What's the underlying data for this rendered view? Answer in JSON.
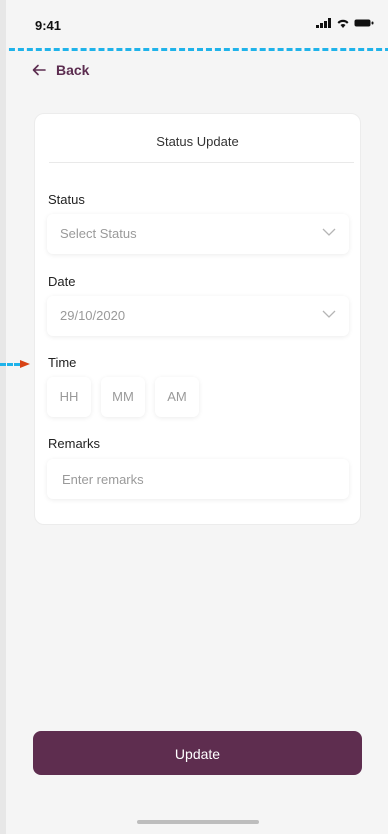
{
  "status_bar": {
    "time": "9:41"
  },
  "nav": {
    "back_label": "Back"
  },
  "card": {
    "title": "Status Update",
    "status": {
      "label": "Status",
      "placeholder": "Select Status"
    },
    "date": {
      "label": "Date",
      "value": "29/10/2020"
    },
    "time": {
      "label": "Time",
      "hour": "HH",
      "minute": "MM",
      "period": "AM"
    },
    "remarks": {
      "label": "Remarks",
      "placeholder": "Enter remarks"
    }
  },
  "actions": {
    "update_label": "Update"
  },
  "colors": {
    "accent": "#5e2d4f",
    "guide": "#1fb3ea",
    "marker": "#d84315"
  }
}
